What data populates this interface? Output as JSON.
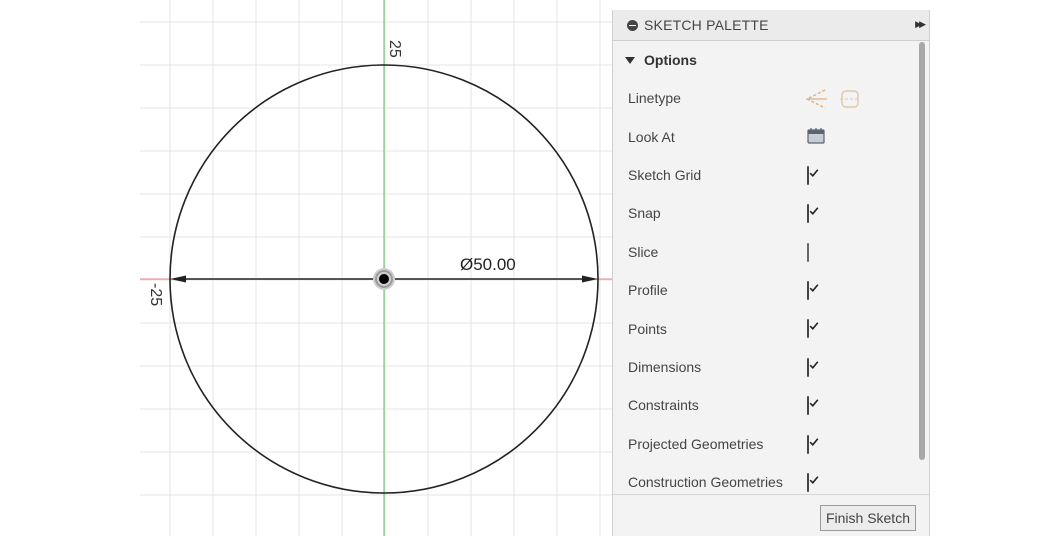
{
  "sketch": {
    "top_label": "25",
    "left_label": "-25",
    "dimension_label": "Ø50.00"
  },
  "palette": {
    "title": "SKETCH PALETTE",
    "section_label": "Options",
    "rows": [
      {
        "label": "Linetype",
        "control": "linetype-icons"
      },
      {
        "label": "Look At",
        "control": "look-at-icon"
      },
      {
        "label": "Sketch Grid",
        "control": "checkbox",
        "checked": true
      },
      {
        "label": "Snap",
        "control": "checkbox",
        "checked": true
      },
      {
        "label": "Slice",
        "control": "checkbox",
        "checked": false
      },
      {
        "label": "Profile",
        "control": "checkbox",
        "checked": true
      },
      {
        "label": "Points",
        "control": "checkbox",
        "checked": true
      },
      {
        "label": "Dimensions",
        "control": "checkbox",
        "checked": true
      },
      {
        "label": "Constraints",
        "control": "checkbox",
        "checked": true
      },
      {
        "label": "Projected Geometries",
        "control": "checkbox",
        "checked": true
      },
      {
        "label": "Construction Geometries",
        "control": "checkbox",
        "checked": true
      }
    ],
    "finish_label": "Finish Sketch"
  },
  "colors": {
    "axis_vertical": "#4fc44f",
    "axis_horizontal": "#e88080",
    "grid": "#e4e4e4",
    "geometry": "#222222"
  }
}
